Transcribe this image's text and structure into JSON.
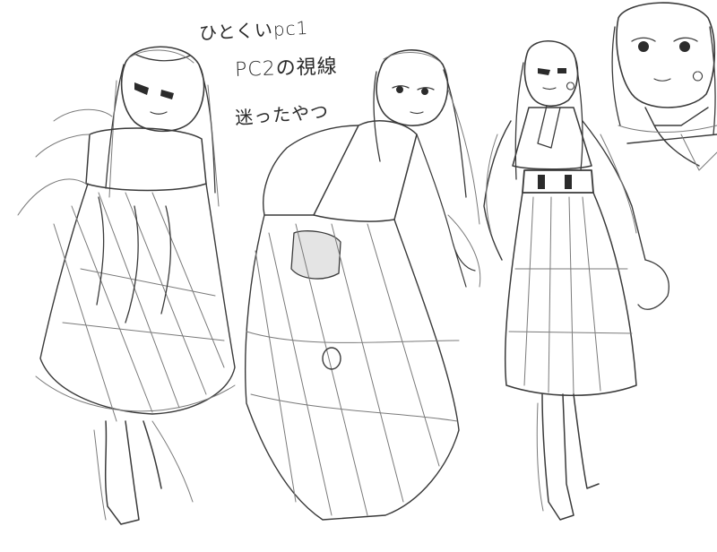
{
  "notes": {
    "line1": "ひとくいpc1",
    "line2": "PC2の視線",
    "line3": "迷ったやつ"
  },
  "colors": {
    "paper": "#ffffff",
    "pencil": "#3a3a3a",
    "pencil_light": "#7a7a7a"
  }
}
